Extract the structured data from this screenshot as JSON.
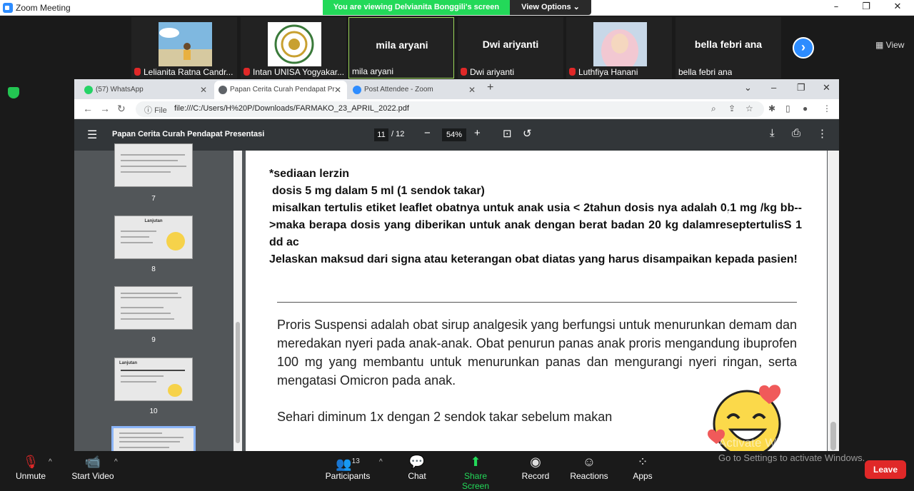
{
  "app": {
    "title": "Zoom Meeting"
  },
  "banner": {
    "viewing": "You are viewing Delvianita Bonggili's screen",
    "view_options": "View Options"
  },
  "window_controls": {
    "minimize": "–",
    "restore": "❐",
    "close": "✕"
  },
  "participants_strip": {
    "tiles": [
      {
        "name": "",
        "label": "Lelianita Ratna Candr...",
        "muted": true,
        "has_video": true
      },
      {
        "name": "",
        "label": "Intan UNISA Yogyakar...",
        "muted": true,
        "has_video": true
      },
      {
        "name": "mila aryani",
        "label": "mila aryani",
        "muted": false,
        "has_video": false
      },
      {
        "name": "Dwi ariyanti",
        "label": "Dwi ariyanti",
        "muted": true,
        "has_video": false
      },
      {
        "name": "",
        "label": "Luthfiya Hanani",
        "muted": true,
        "has_video": true
      },
      {
        "name": "bella febri ana",
        "label": "bella febri ana",
        "muted": false,
        "has_video": false
      }
    ],
    "next_icon": "chevron-right-icon",
    "view_label": "View"
  },
  "browser": {
    "tabs": [
      {
        "label": "(57) WhatsApp",
        "icon": "whatsapp-icon",
        "color": "#25d366"
      },
      {
        "label": "Papan Cerita Curah Pendapat Pr",
        "icon": "globe-icon",
        "color": "#5f6368"
      },
      {
        "label": "Post Attendee - Zoom",
        "icon": "zoom-icon",
        "color": "#2d8cff"
      }
    ],
    "address": {
      "scheme_label": "File",
      "url": "file:///C:/Users/H%20P/Downloads/FARMAKO_23_APRIL_2022.pdf"
    }
  },
  "pdf": {
    "title": "Papan Cerita Curah Pendapat Presentasi",
    "current_page": "11",
    "total_pages": "/ 12",
    "zoom": "54%",
    "thumbnails": [
      {
        "title": "",
        "num": "7"
      },
      {
        "title": "Lanjutan",
        "num": "8"
      },
      {
        "title": "",
        "num": "9"
      },
      {
        "title": "Lanjutan",
        "num": "10"
      },
      {
        "title": "",
        "num": ""
      }
    ],
    "question": {
      "line1": "*sediaan lerzin",
      "line2": "dosis 5 mg dalam 5 ml (1 sendok takar)",
      "line3": "misalkan tertulis etiket leaflet obatnya untuk anak usia < 2tahun dosis nya adalah 0,1 mg /kg bb-->maka berapa dosis yang diberikan untuk anak dengan berat badan 20 kg dalamreseptertulisS 1 dd ac",
      "line4": "Jelaskan maksud dari signa atau keterangan obat diatas yang harus disampaikan kepada pasien!"
    },
    "answer": "Proris Suspensi adalah obat sirup analgesik yang berfungsi untuk menurunkan demam dan meredakan nyeri pada anak-anak. Obat penurun panas anak proris mengandung ibuprofen 100 mg yang membantu untuk menurunkan panas dan mengurangi nyeri ringan, serta mengatasi Omicron pada anak.",
    "dosage": "Sehari diminum 1x dengan 2 sendok takar sebelum makan"
  },
  "toolbar": {
    "unmute": "Unmute",
    "start_video": "Start Video",
    "participants": "Participants",
    "participants_count": "13",
    "chat": "Chat",
    "share_screen": "Share Screen",
    "record": "Record",
    "reactions": "Reactions",
    "apps": "Apps",
    "leave": "Leave"
  },
  "watermark": {
    "line1": "Activate Windows",
    "line2": "Go to Settings to activate Windows."
  },
  "colors": {
    "zoom_blue": "#2d8cff",
    "share_green": "#23d959",
    "leave_red": "#e02828"
  }
}
